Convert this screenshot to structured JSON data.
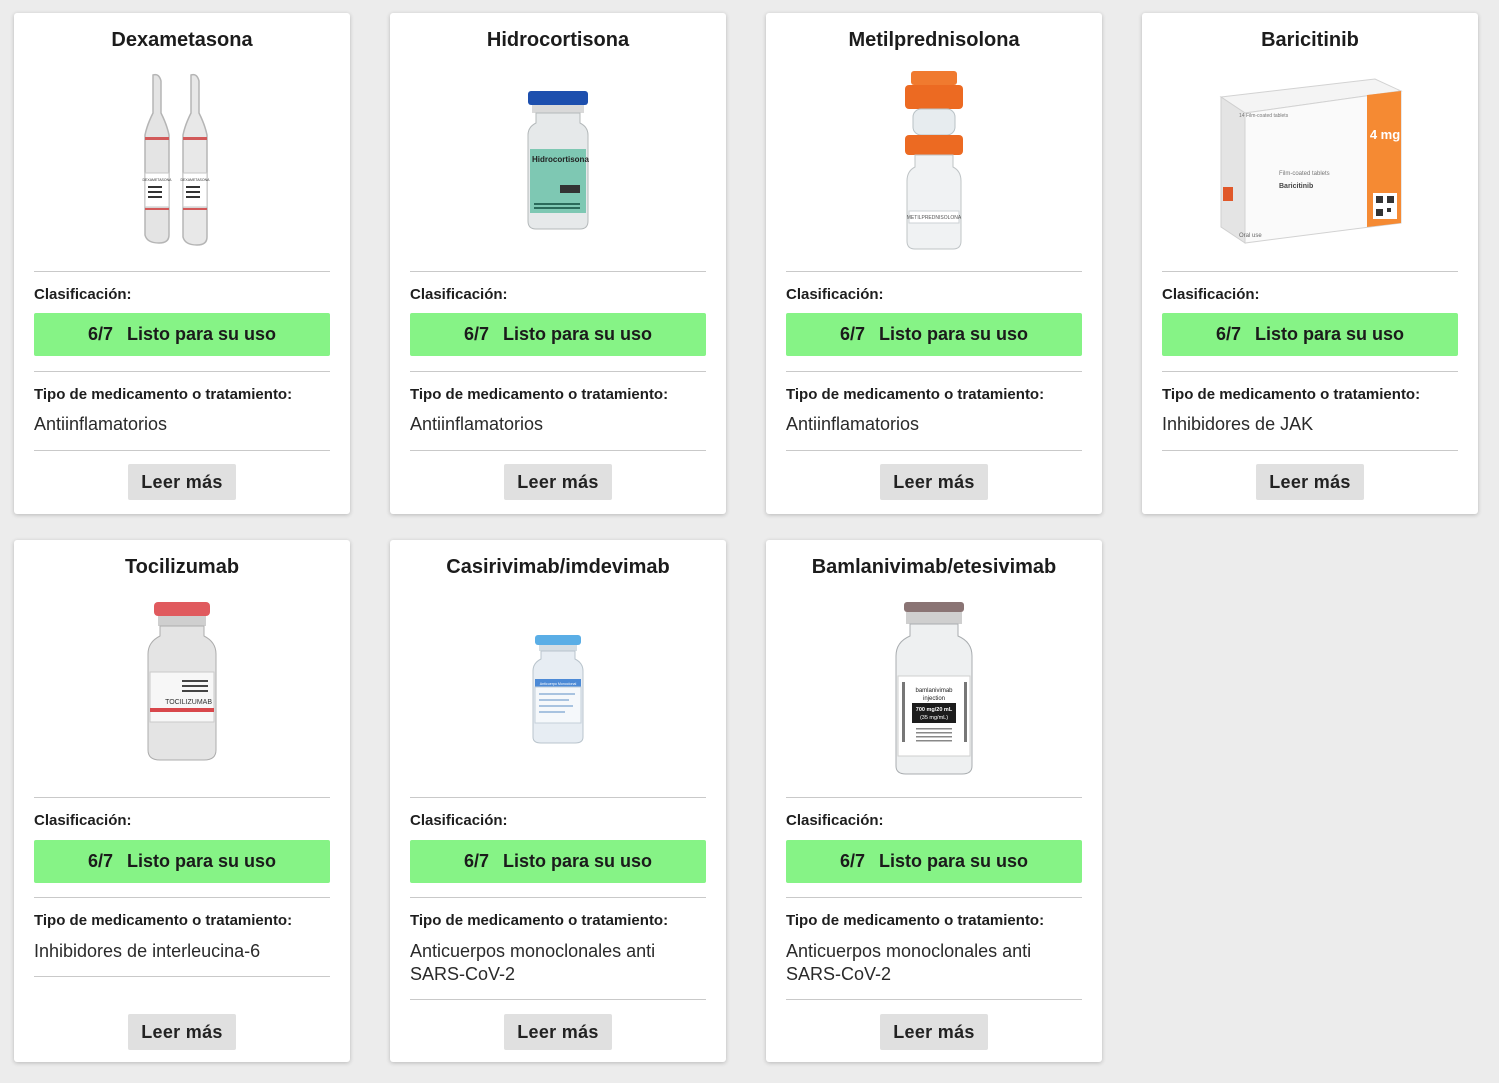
{
  "labels": {
    "classification": "Clasificación:",
    "type": "Tipo de medicamento o tratamiento:",
    "read_more": "Leer más"
  },
  "cards": [
    {
      "title": "Dexametasona",
      "score": "6/7",
      "status": "Listo para su uso",
      "type": "Antiinflamatorios",
      "image": "ampoules-icon",
      "img_text": "DEXAMETASONA"
    },
    {
      "title": "Hidrocortisona",
      "score": "6/7",
      "status": "Listo para su uso",
      "type": "Antiinflamatorios",
      "image": "vial-icon",
      "img_text": "Hidrocortisona"
    },
    {
      "title": "Metilprednisolona",
      "score": "6/7",
      "status": "Listo para su uso",
      "type": "Antiinflamatorios",
      "image": "mixvial-icon",
      "img_text": "METILPREDNISOLONA"
    },
    {
      "title": "Baricitinib",
      "score": "6/7",
      "status": "Listo para su uso",
      "type": "Inhibidores de JAK",
      "image": "pill-box-icon",
      "img_text": "Baricitinib",
      "img_box_small": "14 Film-coated tablets",
      "img_box_sub": "Film-coated tablets",
      "img_box_dose": "4 mg",
      "img_box_use": "Oral use"
    },
    {
      "title": "Tocilizumab",
      "score": "6/7",
      "status": "Listo para su uso",
      "type": "Inhibidores de interleucina-6",
      "image": "vial-icon",
      "img_text": "TOCILIZUMAB"
    },
    {
      "title": "Casirivimab/imdevimab",
      "score": "6/7",
      "status": "Listo para su uso",
      "type": "Anticuerpos monoclonales anti SARS-CoV-2",
      "image": "vial-icon",
      "img_text": "Anticuerpo Monoclonal"
    },
    {
      "title": "Bamlanivimab/etesivimab",
      "score": "6/7",
      "status": "Listo para su uso",
      "type": "Anticuerpos monoclonales anti SARS-CoV-2",
      "image": "vial-icon",
      "img_text": "bamlanivimab",
      "img_sub": "injection",
      "img_dose": "700 mg/20 mL",
      "img_dose2": "(35 mg/mL)"
    }
  ],
  "colors": {
    "status_ok": "#86f386",
    "background": "#ececec"
  }
}
